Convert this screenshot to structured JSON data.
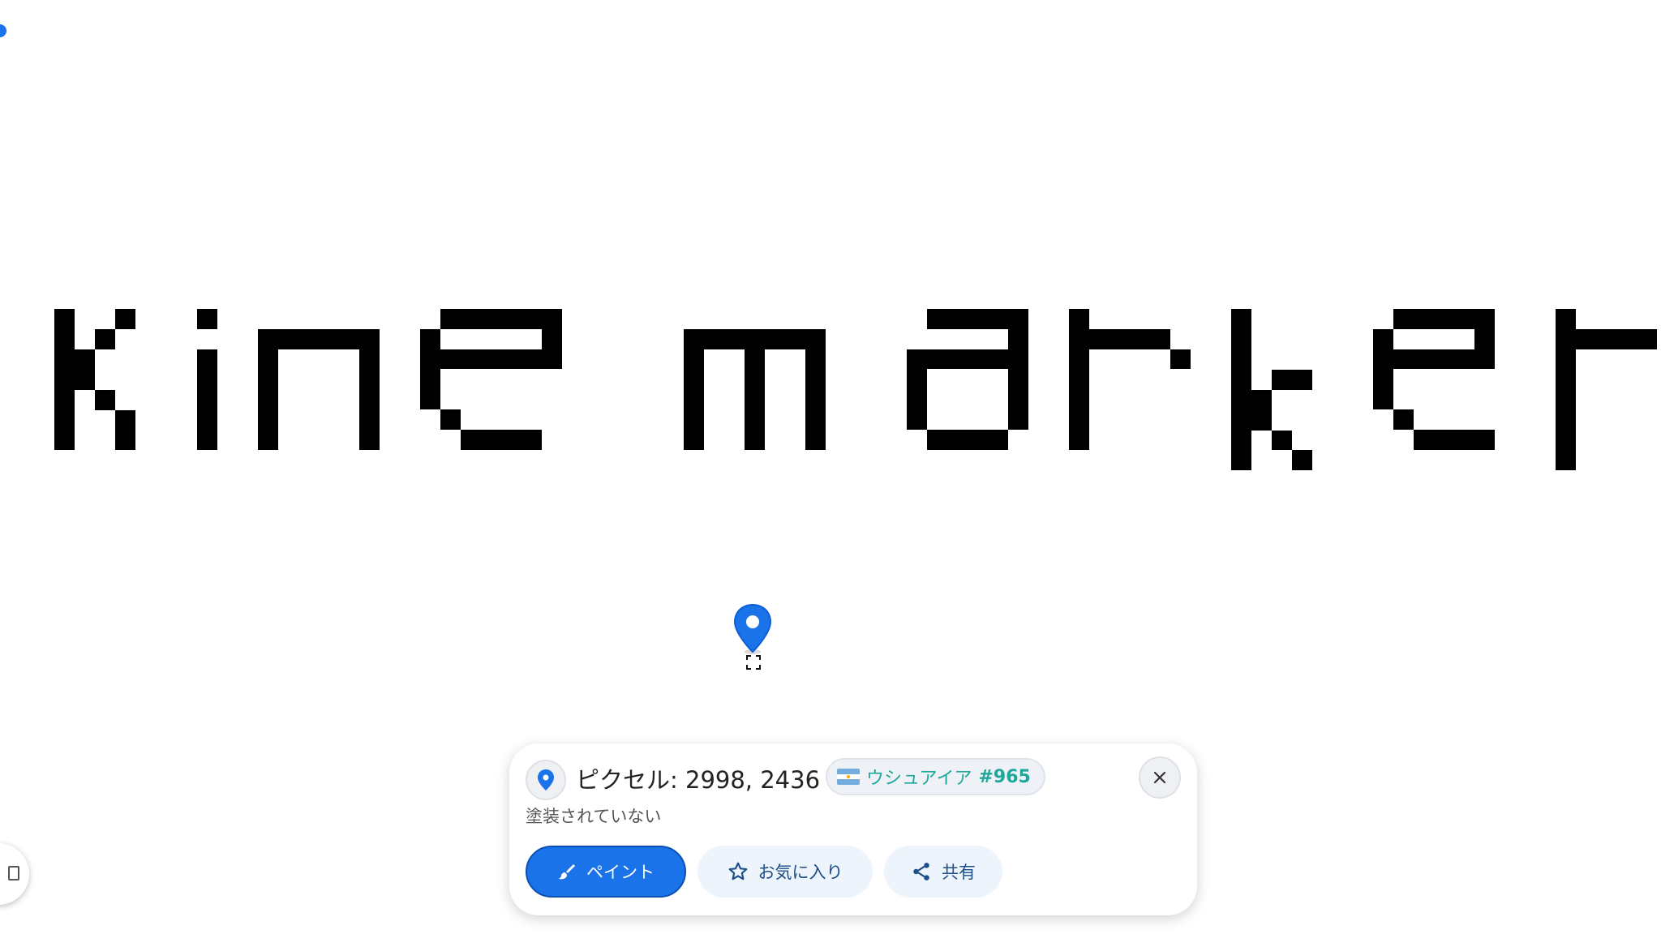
{
  "canvas": {
    "pixel_text": "kine marker",
    "text_color": "#000000",
    "background_color": "#ffffff"
  },
  "pin": {
    "color": "#1a73e8"
  },
  "panel": {
    "title": "ピクセル: 2998, 2436",
    "region_chip": {
      "flag": "argentina-flag-icon",
      "name": "ウシュアイア",
      "number": "#965"
    },
    "status": "塗装されていない",
    "actions": {
      "paint_label": "ペイント",
      "favorite_label": "お気に入り",
      "share_label": "共有"
    },
    "colors": {
      "accent": "#1a73e8",
      "region_text": "#1ea79a"
    }
  }
}
